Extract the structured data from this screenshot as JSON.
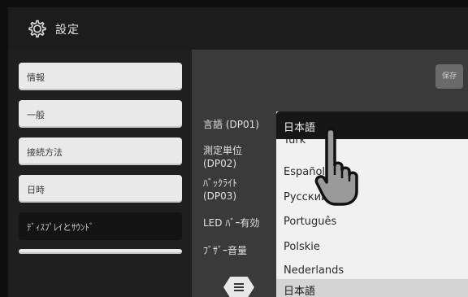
{
  "header": {
    "title": "設定",
    "icon": "gear-icon"
  },
  "sidebar": {
    "items": [
      {
        "label": "情報"
      },
      {
        "label": "一般"
      },
      {
        "label": "接続方法"
      },
      {
        "label": "日時"
      },
      {
        "label": "ﾃﾞｨｽﾌﾟﾚｲとｻｳﾝﾄﾞ"
      }
    ]
  },
  "panel": {
    "save_label": "保存",
    "settings": [
      {
        "label": "言語 (DP01)"
      },
      {
        "label": "測定単位\n(DP02)"
      },
      {
        "label": "ﾊﾞｯｸﾗｲﾄ\n(DP03)"
      },
      {
        "label": "LED ﾊﾞｰ有効"
      },
      {
        "label": "ﾌﾞｻﾞｰ音量"
      }
    ]
  },
  "dropdown": {
    "selected": "日本語",
    "options": [
      "Türk",
      "Español",
      "Русский",
      "Português",
      "Polskie",
      "Nederlands",
      "日本語"
    ]
  },
  "menu": {
    "icon": "menu-icon"
  },
  "overlay": {
    "icon": "hand-pointer-icon"
  }
}
